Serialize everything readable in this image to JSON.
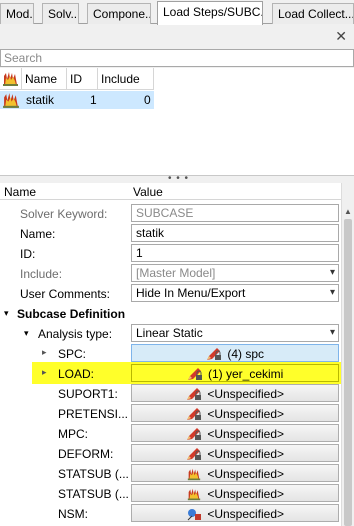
{
  "tabs": [
    {
      "label": "Mod..."
    },
    {
      "label": "Solv..."
    },
    {
      "label": "Compone..."
    },
    {
      "label": "Load Steps/SUBC..."
    },
    {
      "label": "Load Collect..."
    }
  ],
  "panel": {
    "close_glyph": "✕"
  },
  "search": {
    "placeholder": "Search"
  },
  "list": {
    "headers": {
      "icon": "",
      "name": "Name",
      "id": "ID",
      "include": "Include"
    },
    "rows": [
      {
        "name": "statik",
        "id": "1",
        "include": "0"
      }
    ]
  },
  "splitter": {
    "grip": "• • •"
  },
  "properties": {
    "header": {
      "name": "Name",
      "value": "Value"
    },
    "rows": {
      "solver_keyword": {
        "label": "Solver Keyword:",
        "value": "SUBCASE"
      },
      "name": {
        "label": "Name:",
        "value": "statik"
      },
      "id": {
        "label": "ID:",
        "value": "1"
      },
      "include": {
        "label": "Include:",
        "value": "[Master Model]"
      },
      "user_comments": {
        "label": "User Comments:",
        "value": "Hide In Menu/Export"
      },
      "subcase_definition": {
        "label": "Subcase Definition"
      },
      "analysis_type": {
        "label": "Analysis type:",
        "value": "Linear Static"
      },
      "spc": {
        "label": "SPC:",
        "value": "(4) spc"
      },
      "load": {
        "label": "LOAD:",
        "value": "(1) yer_cekimi"
      },
      "suport1": {
        "label": "SUPORT1:",
        "value": "<Unspecified>"
      },
      "pretensi": {
        "label": "PRETENSI...",
        "value": "<Unspecified>"
      },
      "mpc": {
        "label": "MPC:",
        "value": "<Unspecified>"
      },
      "deform": {
        "label": "DEFORM:",
        "value": "<Unspecified>"
      },
      "statsub1": {
        "label": "STATSUB (...",
        "value": "<Unspecified>"
      },
      "statsub2": {
        "label": "STATSUB (...",
        "value": "<Unspecified>"
      },
      "nsm": {
        "label": "NSM:",
        "value": "<Unspecified>"
      }
    }
  },
  "colors": {
    "selection": "#cde8ff",
    "highlight": "#ffff2a",
    "spc_button": "#d7ebf8"
  },
  "icons": {
    "loadstep": "loadstep-icon",
    "pencil": "pencil-lock-icon",
    "loadstep_small": "loadstep-icon",
    "nsm": "nsm-icon",
    "arrow_down": "▾",
    "arrow_right": "▸",
    "dropdown": "▾"
  }
}
